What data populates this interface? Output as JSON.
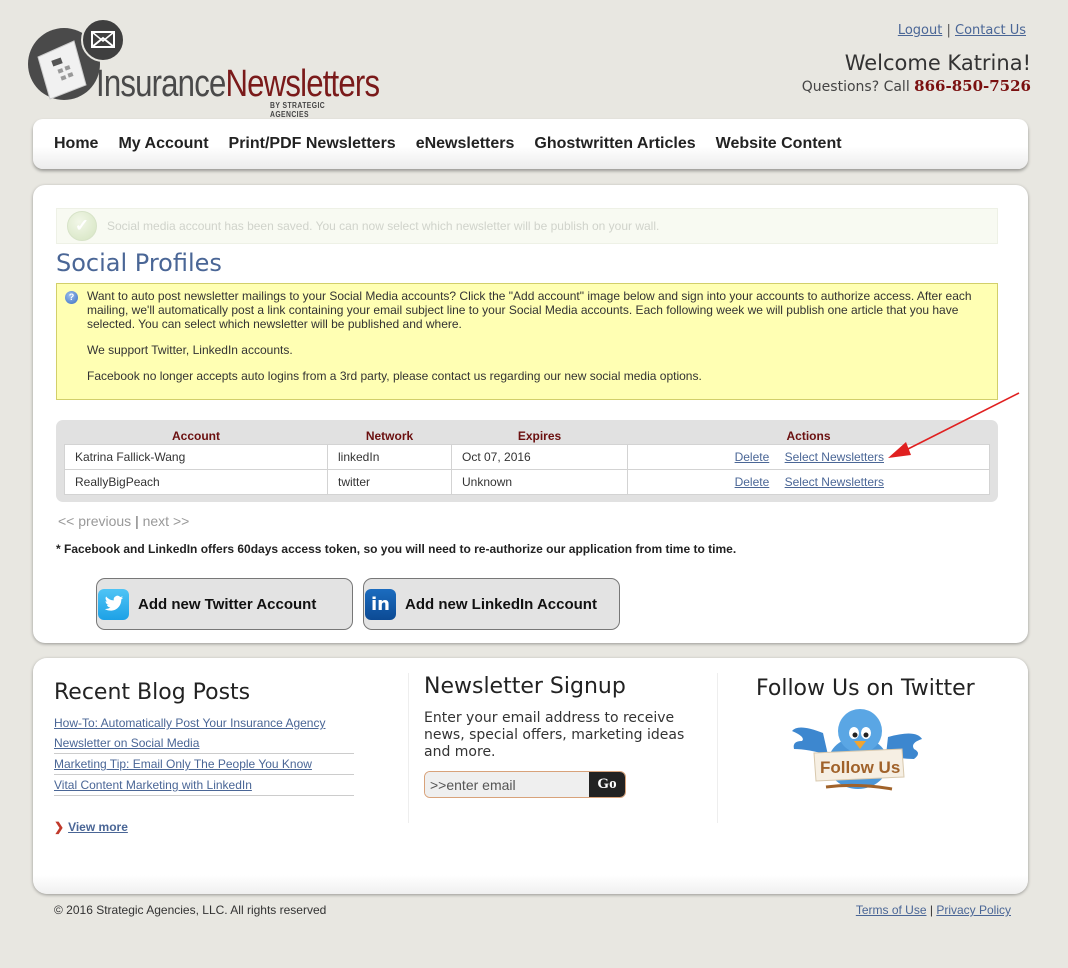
{
  "brand": {
    "name_part1": "Insurance",
    "name_part2": "Newsletters",
    "tagline": "BY STRATEGIC AGENCIES",
    "accent_color": "#7a1a1a"
  },
  "header": {
    "logout": "Logout",
    "separator": "|",
    "contact": "Contact Us",
    "welcome": "Welcome Katrina!",
    "questions_prefix": "Questions? Call",
    "phone": "866-850-7526"
  },
  "nav": {
    "items": [
      {
        "label": "Home"
      },
      {
        "label": "My Account"
      },
      {
        "label": "Print/PDF Newsletters"
      },
      {
        "label": "eNewsletters"
      },
      {
        "label": "Ghostwritten Articles"
      },
      {
        "label": "Website Content"
      }
    ]
  },
  "main": {
    "success_message": "Social media account has been saved. You can now select which newsletter will be publish on your wall.",
    "title": "Social Profiles",
    "info": {
      "paragraph1": "Want to auto post newsletter mailings to your Social Media accounts? Click the \"Add account\" image below and sign into your accounts to authorize access. After each mailing, we'll automatically post a link containing your email subject line to your Social Media accounts. Each following week we will publish one article that you have selected. You can select which newsletter will be published and where.",
      "paragraph2": "We support Twitter, LinkedIn accounts.",
      "paragraph3": "Facebook no longer accepts auto logins from a 3rd party, please contact us regarding our new social media options."
    },
    "table": {
      "headers": [
        "Account",
        "Network",
        "Expires",
        "Actions"
      ],
      "rows": [
        {
          "account": "Katrina Fallick-Wang",
          "network": "linkedIn",
          "expires": "Oct 07, 2016",
          "delete": "Delete",
          "select": "Select Newsletters"
        },
        {
          "account": "ReallyBigPeach",
          "network": "twitter",
          "expires": "Unknown",
          "delete": "Delete",
          "select": "Select Newsletters"
        }
      ]
    },
    "pager": {
      "previous": "<< previous",
      "separator": "|",
      "next": "next >>"
    },
    "note": "* Facebook and LinkedIn offers 60days access token, so you will need to re-authorize our application from time to time.",
    "add_twitter": "Add new Twitter Account",
    "add_linkedin": "Add new LinkedIn Account",
    "twitter_icon_glyph": "🐦",
    "linkedin_icon_glyph": "in",
    "annotation_arrow_color": "#e02020"
  },
  "widgets": {
    "blog": {
      "title": "Recent Blog Posts",
      "posts": [
        "How-To: Automatically Post Your Insurance Agency Newsletter on Social Media",
        "Marketing Tip: Email Only The People You Know",
        "Vital Content Marketing with LinkedIn"
      ],
      "view_more": "View more"
    },
    "signup": {
      "title": "Newsletter Signup",
      "description": "Enter your email address to receive news, special offers, marketing ideas and more.",
      "email_placeholder": ">>enter email",
      "email_value": "",
      "go": "Go"
    },
    "follow": {
      "title": "Follow Us on Twitter",
      "sign_text": "Follow Us"
    }
  },
  "footer": {
    "copyright": "© 2016 Strategic Agencies, LLC. All rights reserved",
    "terms": "Terms of Use",
    "separator": "|",
    "privacy": "Privacy Policy"
  }
}
